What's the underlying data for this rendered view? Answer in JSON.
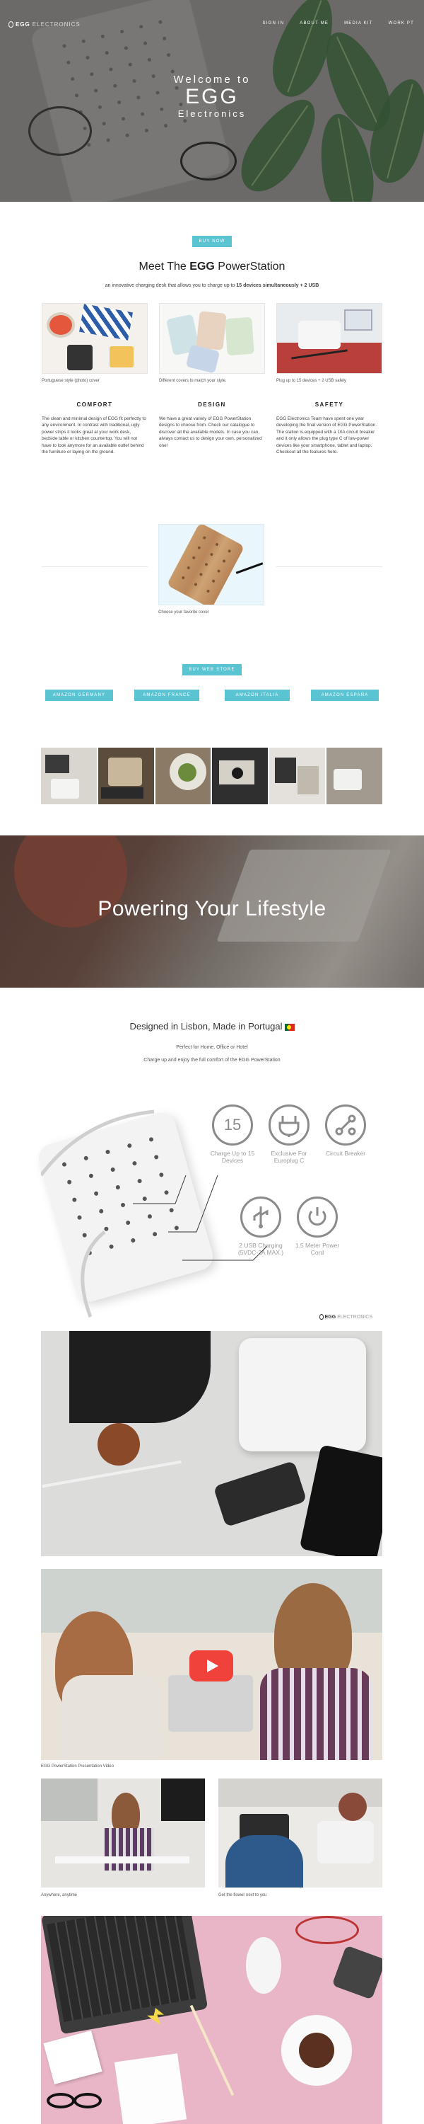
{
  "header": {
    "logo_bold": "EGG",
    "logo_light": "ELECTRONICS",
    "nav": [
      "SIGN IN",
      "ABOUT ME",
      "MEDIA KIT",
      "WORK PT"
    ]
  },
  "hero": {
    "welcome": "Welcome to",
    "egg": "EGG",
    "electronics": "Electronics"
  },
  "buy_now": "BUY NOW",
  "meet": {
    "title_pre": "Meet The ",
    "title_bold": "EGG",
    "title_post": " PowerStation",
    "sub_pre": "an innovative charging desk that allows you to charge up to ",
    "sub_bold": "15 devices simultaneously + 2 USB"
  },
  "columns": [
    {
      "caption": "Portuguese style (photo) cover",
      "heading": "COMFORT",
      "text": "The clean and minimal design of EGG fit perfectly to any environment. In contrast with traditional, ugly power strips it looks great at your work desk, bedside table or kitchen countertop. You will not have to look anymore for an available outlet behind the furniture or laying on the ground."
    },
    {
      "caption": "Different covers to match your style.",
      "heading": "DESIGN",
      "text": "We have a great variety of EGG PowerStation designs to choose from. Check our catalogue to discover all the available models. In case you can, always contact us to design your own, personalized one!"
    },
    {
      "caption": "Plug up to 15 devices + 2 USB safely",
      "heading": "SAFETY",
      "text": "EGG Electronics Team have spent one year developing the final version of EGG PowerStation. The station is equipped with a 10A circuit breaker and it only allows the plug type C of low-power devices like your smartphone, tablet and laptop. Checkout all the features here."
    }
  ],
  "wood_caption": "Choose your favorite cover",
  "buy_web_store": "BUY WEB STORE",
  "amazon_buttons": [
    "AMAZON GERMANY",
    "AMAZON FRANCE",
    "AMAZON ITALIA",
    "AMAZON ESPAÑA"
  ],
  "powering": "Powering Your Lifestyle",
  "designed": {
    "title": "Designed in Lisbon, Made in Portugal",
    "line1": "Perfect for Home, Office or Hotel",
    "line2": "Charge up and enjoy the full comfort of the EGG PowerStation"
  },
  "features": [
    {
      "icon": "15",
      "label": "Charge Up to 15 Devices"
    },
    {
      "icon": "plug",
      "label": "Exclusive For Europlug C"
    },
    {
      "icon": "breaker",
      "label": "Circuit Breaker"
    },
    {
      "icon": "usb",
      "label": "2 USB Charging (5VDC-2A MAX.)"
    },
    {
      "icon": "cord",
      "label": "1.5 Meter Power Cord"
    }
  ],
  "diagram_logo_bold": "EGG",
  "diagram_logo_light": "ELECTRONICS",
  "video_caption": "EGG PowerStation Presentation Video",
  "anywhere_caption": "Anywhere, anytime",
  "flower_caption": "Get the flower next to you",
  "colors": {
    "accent": "#5bc4d3",
    "hero_overlay": "#7b7a78",
    "play": "#f0413a",
    "feature_gray": "#8b8b8b"
  }
}
